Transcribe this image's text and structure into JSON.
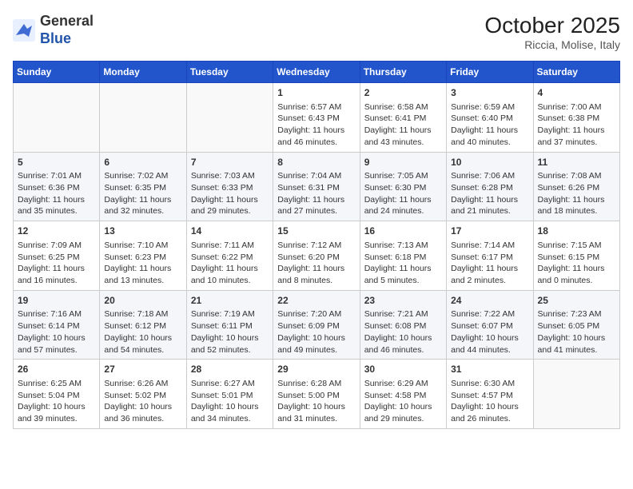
{
  "header": {
    "logo_general": "General",
    "logo_blue": "Blue",
    "title": "October 2025",
    "subtitle": "Riccia, Molise, Italy"
  },
  "weekdays": [
    "Sunday",
    "Monday",
    "Tuesday",
    "Wednesday",
    "Thursday",
    "Friday",
    "Saturday"
  ],
  "weeks": [
    [
      {
        "day": "",
        "content": ""
      },
      {
        "day": "",
        "content": ""
      },
      {
        "day": "",
        "content": ""
      },
      {
        "day": "1",
        "content": "Sunrise: 6:57 AM\nSunset: 6:43 PM\nDaylight: 11 hours and 46 minutes."
      },
      {
        "day": "2",
        "content": "Sunrise: 6:58 AM\nSunset: 6:41 PM\nDaylight: 11 hours and 43 minutes."
      },
      {
        "day": "3",
        "content": "Sunrise: 6:59 AM\nSunset: 6:40 PM\nDaylight: 11 hours and 40 minutes."
      },
      {
        "day": "4",
        "content": "Sunrise: 7:00 AM\nSunset: 6:38 PM\nDaylight: 11 hours and 37 minutes."
      }
    ],
    [
      {
        "day": "5",
        "content": "Sunrise: 7:01 AM\nSunset: 6:36 PM\nDaylight: 11 hours and 35 minutes."
      },
      {
        "day": "6",
        "content": "Sunrise: 7:02 AM\nSunset: 6:35 PM\nDaylight: 11 hours and 32 minutes."
      },
      {
        "day": "7",
        "content": "Sunrise: 7:03 AM\nSunset: 6:33 PM\nDaylight: 11 hours and 29 minutes."
      },
      {
        "day": "8",
        "content": "Sunrise: 7:04 AM\nSunset: 6:31 PM\nDaylight: 11 hours and 27 minutes."
      },
      {
        "day": "9",
        "content": "Sunrise: 7:05 AM\nSunset: 6:30 PM\nDaylight: 11 hours and 24 minutes."
      },
      {
        "day": "10",
        "content": "Sunrise: 7:06 AM\nSunset: 6:28 PM\nDaylight: 11 hours and 21 minutes."
      },
      {
        "day": "11",
        "content": "Sunrise: 7:08 AM\nSunset: 6:26 PM\nDaylight: 11 hours and 18 minutes."
      }
    ],
    [
      {
        "day": "12",
        "content": "Sunrise: 7:09 AM\nSunset: 6:25 PM\nDaylight: 11 hours and 16 minutes."
      },
      {
        "day": "13",
        "content": "Sunrise: 7:10 AM\nSunset: 6:23 PM\nDaylight: 11 hours and 13 minutes."
      },
      {
        "day": "14",
        "content": "Sunrise: 7:11 AM\nSunset: 6:22 PM\nDaylight: 11 hours and 10 minutes."
      },
      {
        "day": "15",
        "content": "Sunrise: 7:12 AM\nSunset: 6:20 PM\nDaylight: 11 hours and 8 minutes."
      },
      {
        "day": "16",
        "content": "Sunrise: 7:13 AM\nSunset: 6:18 PM\nDaylight: 11 hours and 5 minutes."
      },
      {
        "day": "17",
        "content": "Sunrise: 7:14 AM\nSunset: 6:17 PM\nDaylight: 11 hours and 2 minutes."
      },
      {
        "day": "18",
        "content": "Sunrise: 7:15 AM\nSunset: 6:15 PM\nDaylight: 11 hours and 0 minutes."
      }
    ],
    [
      {
        "day": "19",
        "content": "Sunrise: 7:16 AM\nSunset: 6:14 PM\nDaylight: 10 hours and 57 minutes."
      },
      {
        "day": "20",
        "content": "Sunrise: 7:18 AM\nSunset: 6:12 PM\nDaylight: 10 hours and 54 minutes."
      },
      {
        "day": "21",
        "content": "Sunrise: 7:19 AM\nSunset: 6:11 PM\nDaylight: 10 hours and 52 minutes."
      },
      {
        "day": "22",
        "content": "Sunrise: 7:20 AM\nSunset: 6:09 PM\nDaylight: 10 hours and 49 minutes."
      },
      {
        "day": "23",
        "content": "Sunrise: 7:21 AM\nSunset: 6:08 PM\nDaylight: 10 hours and 46 minutes."
      },
      {
        "day": "24",
        "content": "Sunrise: 7:22 AM\nSunset: 6:07 PM\nDaylight: 10 hours and 44 minutes."
      },
      {
        "day": "25",
        "content": "Sunrise: 7:23 AM\nSunset: 6:05 PM\nDaylight: 10 hours and 41 minutes."
      }
    ],
    [
      {
        "day": "26",
        "content": "Sunrise: 6:25 AM\nSunset: 5:04 PM\nDaylight: 10 hours and 39 minutes."
      },
      {
        "day": "27",
        "content": "Sunrise: 6:26 AM\nSunset: 5:02 PM\nDaylight: 10 hours and 36 minutes."
      },
      {
        "day": "28",
        "content": "Sunrise: 6:27 AM\nSunset: 5:01 PM\nDaylight: 10 hours and 34 minutes."
      },
      {
        "day": "29",
        "content": "Sunrise: 6:28 AM\nSunset: 5:00 PM\nDaylight: 10 hours and 31 minutes."
      },
      {
        "day": "30",
        "content": "Sunrise: 6:29 AM\nSunset: 4:58 PM\nDaylight: 10 hours and 29 minutes."
      },
      {
        "day": "31",
        "content": "Sunrise: 6:30 AM\nSunset: 4:57 PM\nDaylight: 10 hours and 26 minutes."
      },
      {
        "day": "",
        "content": ""
      }
    ]
  ]
}
